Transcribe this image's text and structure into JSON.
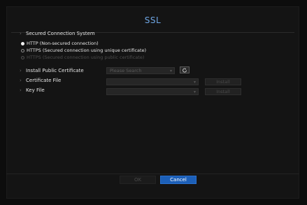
{
  "dialog": {
    "title": "SSL"
  },
  "secured_connection": {
    "label": "Secured Connection System",
    "options": [
      {
        "label": "HTTP (Non-secured connection)",
        "selected": true,
        "enabled": true
      },
      {
        "label": "HTTPS (Secured connection using unique certificate)",
        "selected": false,
        "enabled": true
      },
      {
        "label": "HTTPS (Secured connection using public certificate)",
        "selected": false,
        "enabled": false
      }
    ]
  },
  "install_public_certificate": {
    "label": "Install Public Certificate",
    "combo_value": "Please Search",
    "refresh_icon": "refresh-icon"
  },
  "certificate_file": {
    "label": "Certificate File",
    "combo_value": "",
    "button_label": "Install"
  },
  "key_file": {
    "label": "Key File",
    "combo_value": "",
    "button_label": "Install"
  },
  "footer": {
    "ok_label": "OK",
    "cancel_label": "Cancel"
  },
  "colors": {
    "accent": "#1c5fb8",
    "title": "#6fa7e6"
  }
}
